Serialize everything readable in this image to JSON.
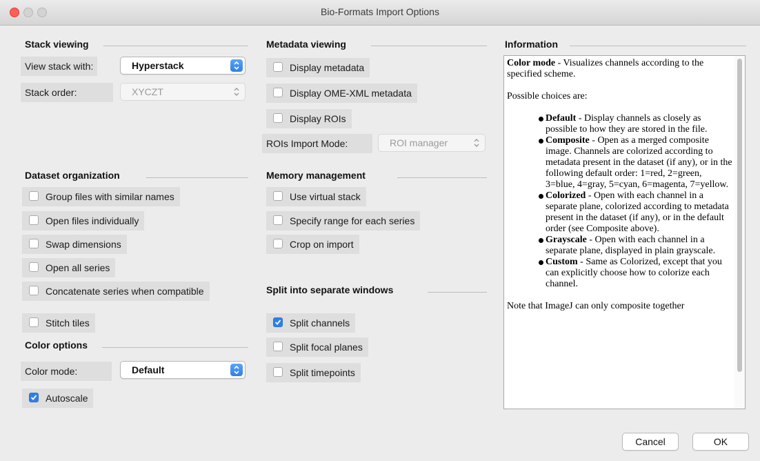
{
  "window": {
    "title": "Bio-Formats Import Options"
  },
  "stack_viewing": {
    "heading": "Stack viewing",
    "view_stack_label": "View stack with:",
    "view_stack_value": "Hyperstack",
    "stack_order_label": "Stack order:",
    "stack_order_value": "XYCZT"
  },
  "dataset_org": {
    "heading": "Dataset organization",
    "items": [
      {
        "label": "Group files with similar names",
        "checked": false
      },
      {
        "label": "Open files individually",
        "checked": false
      },
      {
        "label": "Swap dimensions",
        "checked": false
      },
      {
        "label": "Open all series",
        "checked": false
      },
      {
        "label": "Concatenate series when compatible",
        "checked": false
      },
      {
        "label": "Stitch tiles",
        "checked": false
      }
    ]
  },
  "color_options": {
    "heading": "Color options",
    "color_mode_label": "Color mode:",
    "color_mode_value": "Default",
    "autoscale_label": "Autoscale",
    "autoscale_checked": true
  },
  "metadata_viewing": {
    "heading": "Metadata viewing",
    "items": [
      {
        "label": "Display metadata",
        "checked": false
      },
      {
        "label": "Display OME-XML metadata",
        "checked": false
      },
      {
        "label": "Display ROIs",
        "checked": false
      }
    ],
    "roi_mode_label": "ROIs Import Mode:",
    "roi_mode_value": "ROI manager"
  },
  "memory": {
    "heading": "Memory management",
    "items": [
      {
        "label": "Use virtual stack",
        "checked": false
      },
      {
        "label": "Specify range for each series",
        "checked": false
      },
      {
        "label": "Crop on import",
        "checked": false
      }
    ]
  },
  "split": {
    "heading": "Split into separate windows",
    "items": [
      {
        "label": "Split channels",
        "checked": true
      },
      {
        "label": "Split focal planes",
        "checked": false
      },
      {
        "label": "Split timepoints",
        "checked": false
      }
    ]
  },
  "information": {
    "heading": "Information",
    "intro_bold": "Color mode",
    "intro_text": " - Visualizes channels according to the specified scheme.",
    "choices_text": "Possible choices are:",
    "choices": [
      {
        "name": "Default",
        "desc": " - Display channels as closely as possible to how they are stored in the file."
      },
      {
        "name": "Composite",
        "desc": " - Open as a merged composite image. Channels are colorized according to metadata present in the dataset (if any), or in the following default order: 1=red, 2=green, 3=blue, 4=gray, 5=cyan, 6=magenta, 7=yellow."
      },
      {
        "name": "Colorized",
        "desc": " - Open with each channel in a separate plane, colorized according to metadata present in the dataset (if any), or in the default order (see Composite above)."
      },
      {
        "name": "Grayscale",
        "desc": " - Open with each channel in a separate plane, displayed in plain grayscale."
      },
      {
        "name": "Custom",
        "desc": " - Same as Colorized, except that you can explicitly choose how to colorize each channel."
      }
    ],
    "note": "Note that ImageJ can only composite together"
  },
  "buttons": {
    "cancel": "Cancel",
    "ok": "OK"
  },
  "colors": {
    "accent": "#2f7fe8",
    "close": "#fd5f57"
  }
}
